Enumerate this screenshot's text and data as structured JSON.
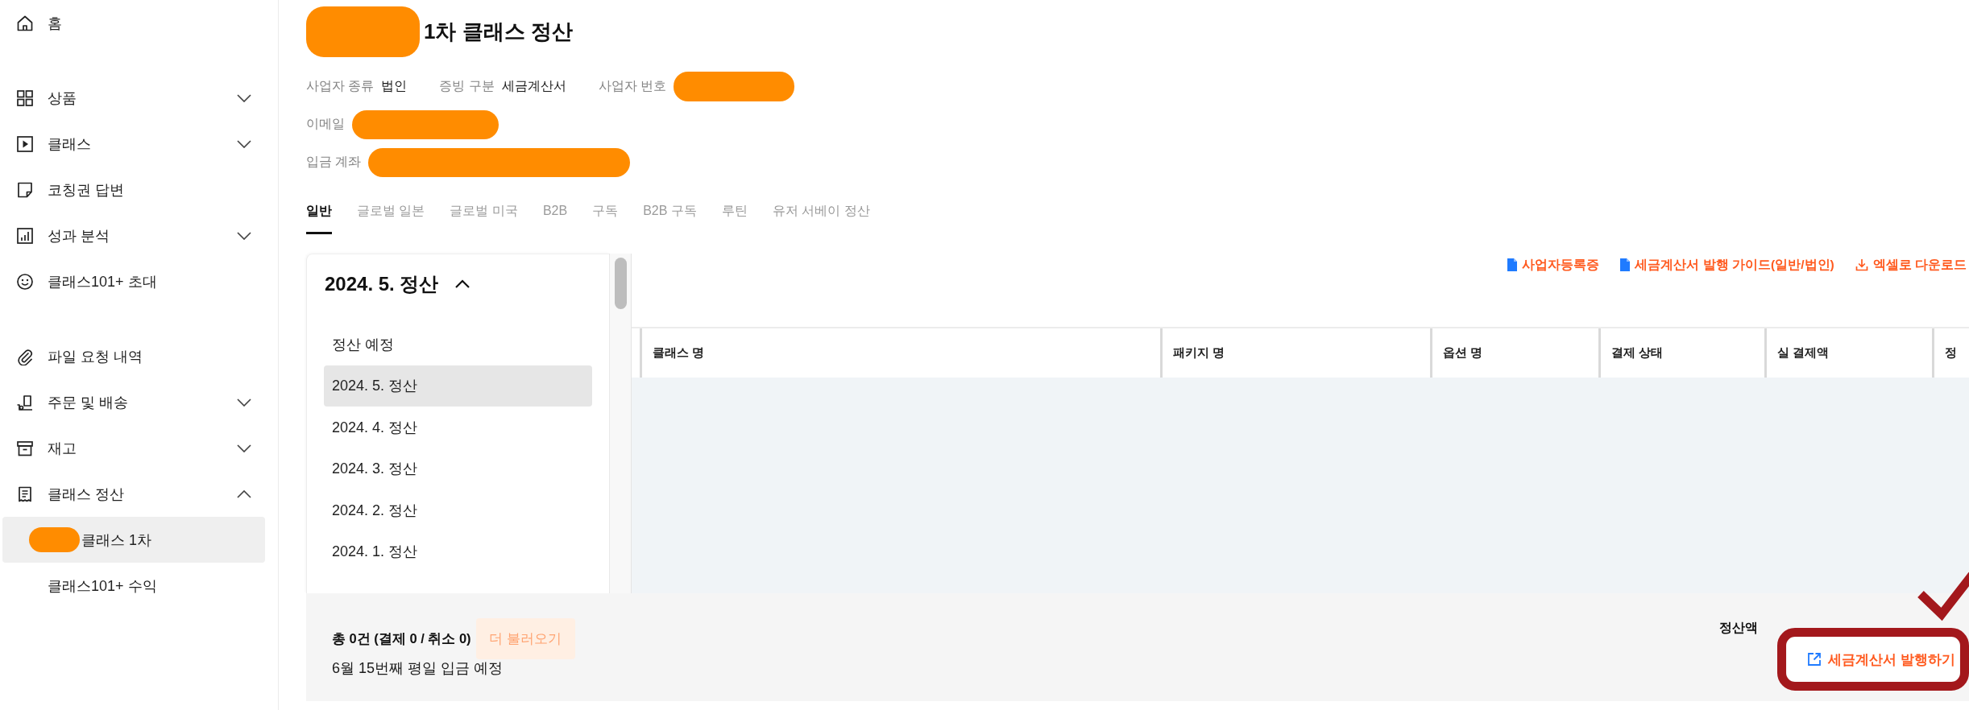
{
  "sidebar": {
    "sections": [
      {
        "items": [
          {
            "label": "홈",
            "selected": false
          }
        ]
      },
      {
        "items": [
          {
            "label": "상품",
            "selected": false,
            "expanded": false
          },
          {
            "label": "클래스",
            "selected": false,
            "expanded": false
          },
          {
            "label": "코칭권 답변",
            "selected": false
          },
          {
            "label": "성과 분석",
            "selected": false,
            "expanded": false
          },
          {
            "label": "클래스101+ 초대",
            "selected": false
          }
        ]
      },
      {
        "items": [
          {
            "label": "파일 요청 내역",
            "selected": false
          },
          {
            "label": "주문 및 배송",
            "selected": false,
            "expanded": false
          },
          {
            "label": "재고",
            "selected": false,
            "expanded": false
          },
          {
            "label": "클래스 정산",
            "selected": false,
            "expanded": true,
            "children": [
              {
                "label": "클래스 1차",
                "selected": true,
                "redacted_prefix": true
              },
              {
                "label": "클래스101+ 수익",
                "selected": false
              }
            ]
          }
        ]
      }
    ]
  },
  "header": {
    "title": "1차 클래스 정산",
    "redacted_prefix": true
  },
  "business_info": [
    [
      {
        "label": "사업자 종류",
        "value": "법인"
      },
      {
        "label": "증빙 구분",
        "value": "세금계산서"
      },
      {
        "label": "사업자 번호",
        "redacted": true
      }
    ],
    [
      {
        "label": "이메일",
        "redacted": true
      }
    ],
    [
      {
        "label": "입금 계좌",
        "redacted": true
      }
    ]
  ],
  "tabs": [
    {
      "label": "일반",
      "selected": true
    },
    {
      "label": "글로벌 일본",
      "selected": false
    },
    {
      "label": "글로벌 미국",
      "selected": false
    },
    {
      "label": "B2B",
      "selected": false
    },
    {
      "label": "구독",
      "selected": false
    },
    {
      "label": "B2B 구독",
      "selected": false
    },
    {
      "label": "루틴",
      "selected": false
    },
    {
      "label": "유저 서베이 정산",
      "selected": false
    }
  ],
  "period_selector": {
    "label": "2024. 5. 정산",
    "expanded": true,
    "options": [
      {
        "label": "정산 예정",
        "selected": false
      },
      {
        "label": "2024. 5. 정산",
        "selected": true
      },
      {
        "label": "2024. 4. 정산",
        "selected": false
      },
      {
        "label": "2024. 3. 정산",
        "selected": false
      },
      {
        "label": "2024. 2. 정산",
        "selected": false
      },
      {
        "label": "2024. 1. 정산",
        "selected": false
      }
    ]
  },
  "actions": [
    {
      "label": "사업자등록증",
      "kind": "document"
    },
    {
      "label": "세금계산서 발행 가이드(일반/법인)",
      "kind": "document"
    },
    {
      "label": "엑셀로 다운로드",
      "kind": "download"
    }
  ],
  "table": {
    "columns": [
      "클래스 명",
      "패키지 명",
      "옵션 명",
      "결제 상태",
      "실 결제액",
      "정"
    ]
  },
  "footer": {
    "summary": "총 0건 (결제 0 / 취소 0)",
    "load_more": {
      "label": "더 불러오기",
      "disabled": true
    },
    "deposit_note": "6월 15번째 평일 입금 예정",
    "total_label": "정산액",
    "issue_button": {
      "label": "세금계산서 발행하기",
      "highlighted": true
    }
  }
}
